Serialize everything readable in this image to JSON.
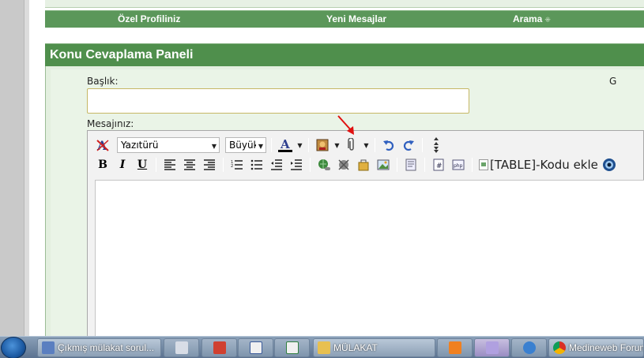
{
  "nav": {
    "items": [
      {
        "label": "Özel Profiliniz"
      },
      {
        "label": "Yeni Mesajlar"
      },
      {
        "label": "Arama"
      }
    ]
  },
  "panel": {
    "title": "Konu Cevaplama Paneli",
    "subject_label": "Başlık:",
    "subject_value": "",
    "right_label_fragment": "G",
    "message_label": "Mesajınız:"
  },
  "editor": {
    "font_select": "Yazıtürü",
    "size_select": "Büyük",
    "table_code_label": "[TABLE]-Kodu ekle",
    "content": ""
  },
  "taskbar": {
    "tasks": [
      {
        "label": "Çıkmış mülakat sorul..."
      },
      {
        "label": "MÜLAKAT"
      },
      {
        "label": "Medineweb Forum"
      }
    ]
  },
  "colors": {
    "panel_green": "#4f8f4c",
    "nav_green": "#5b975a",
    "panel_body": "#e3efdf",
    "input_border": "#c6b765",
    "annotation_red": "#e01010"
  }
}
